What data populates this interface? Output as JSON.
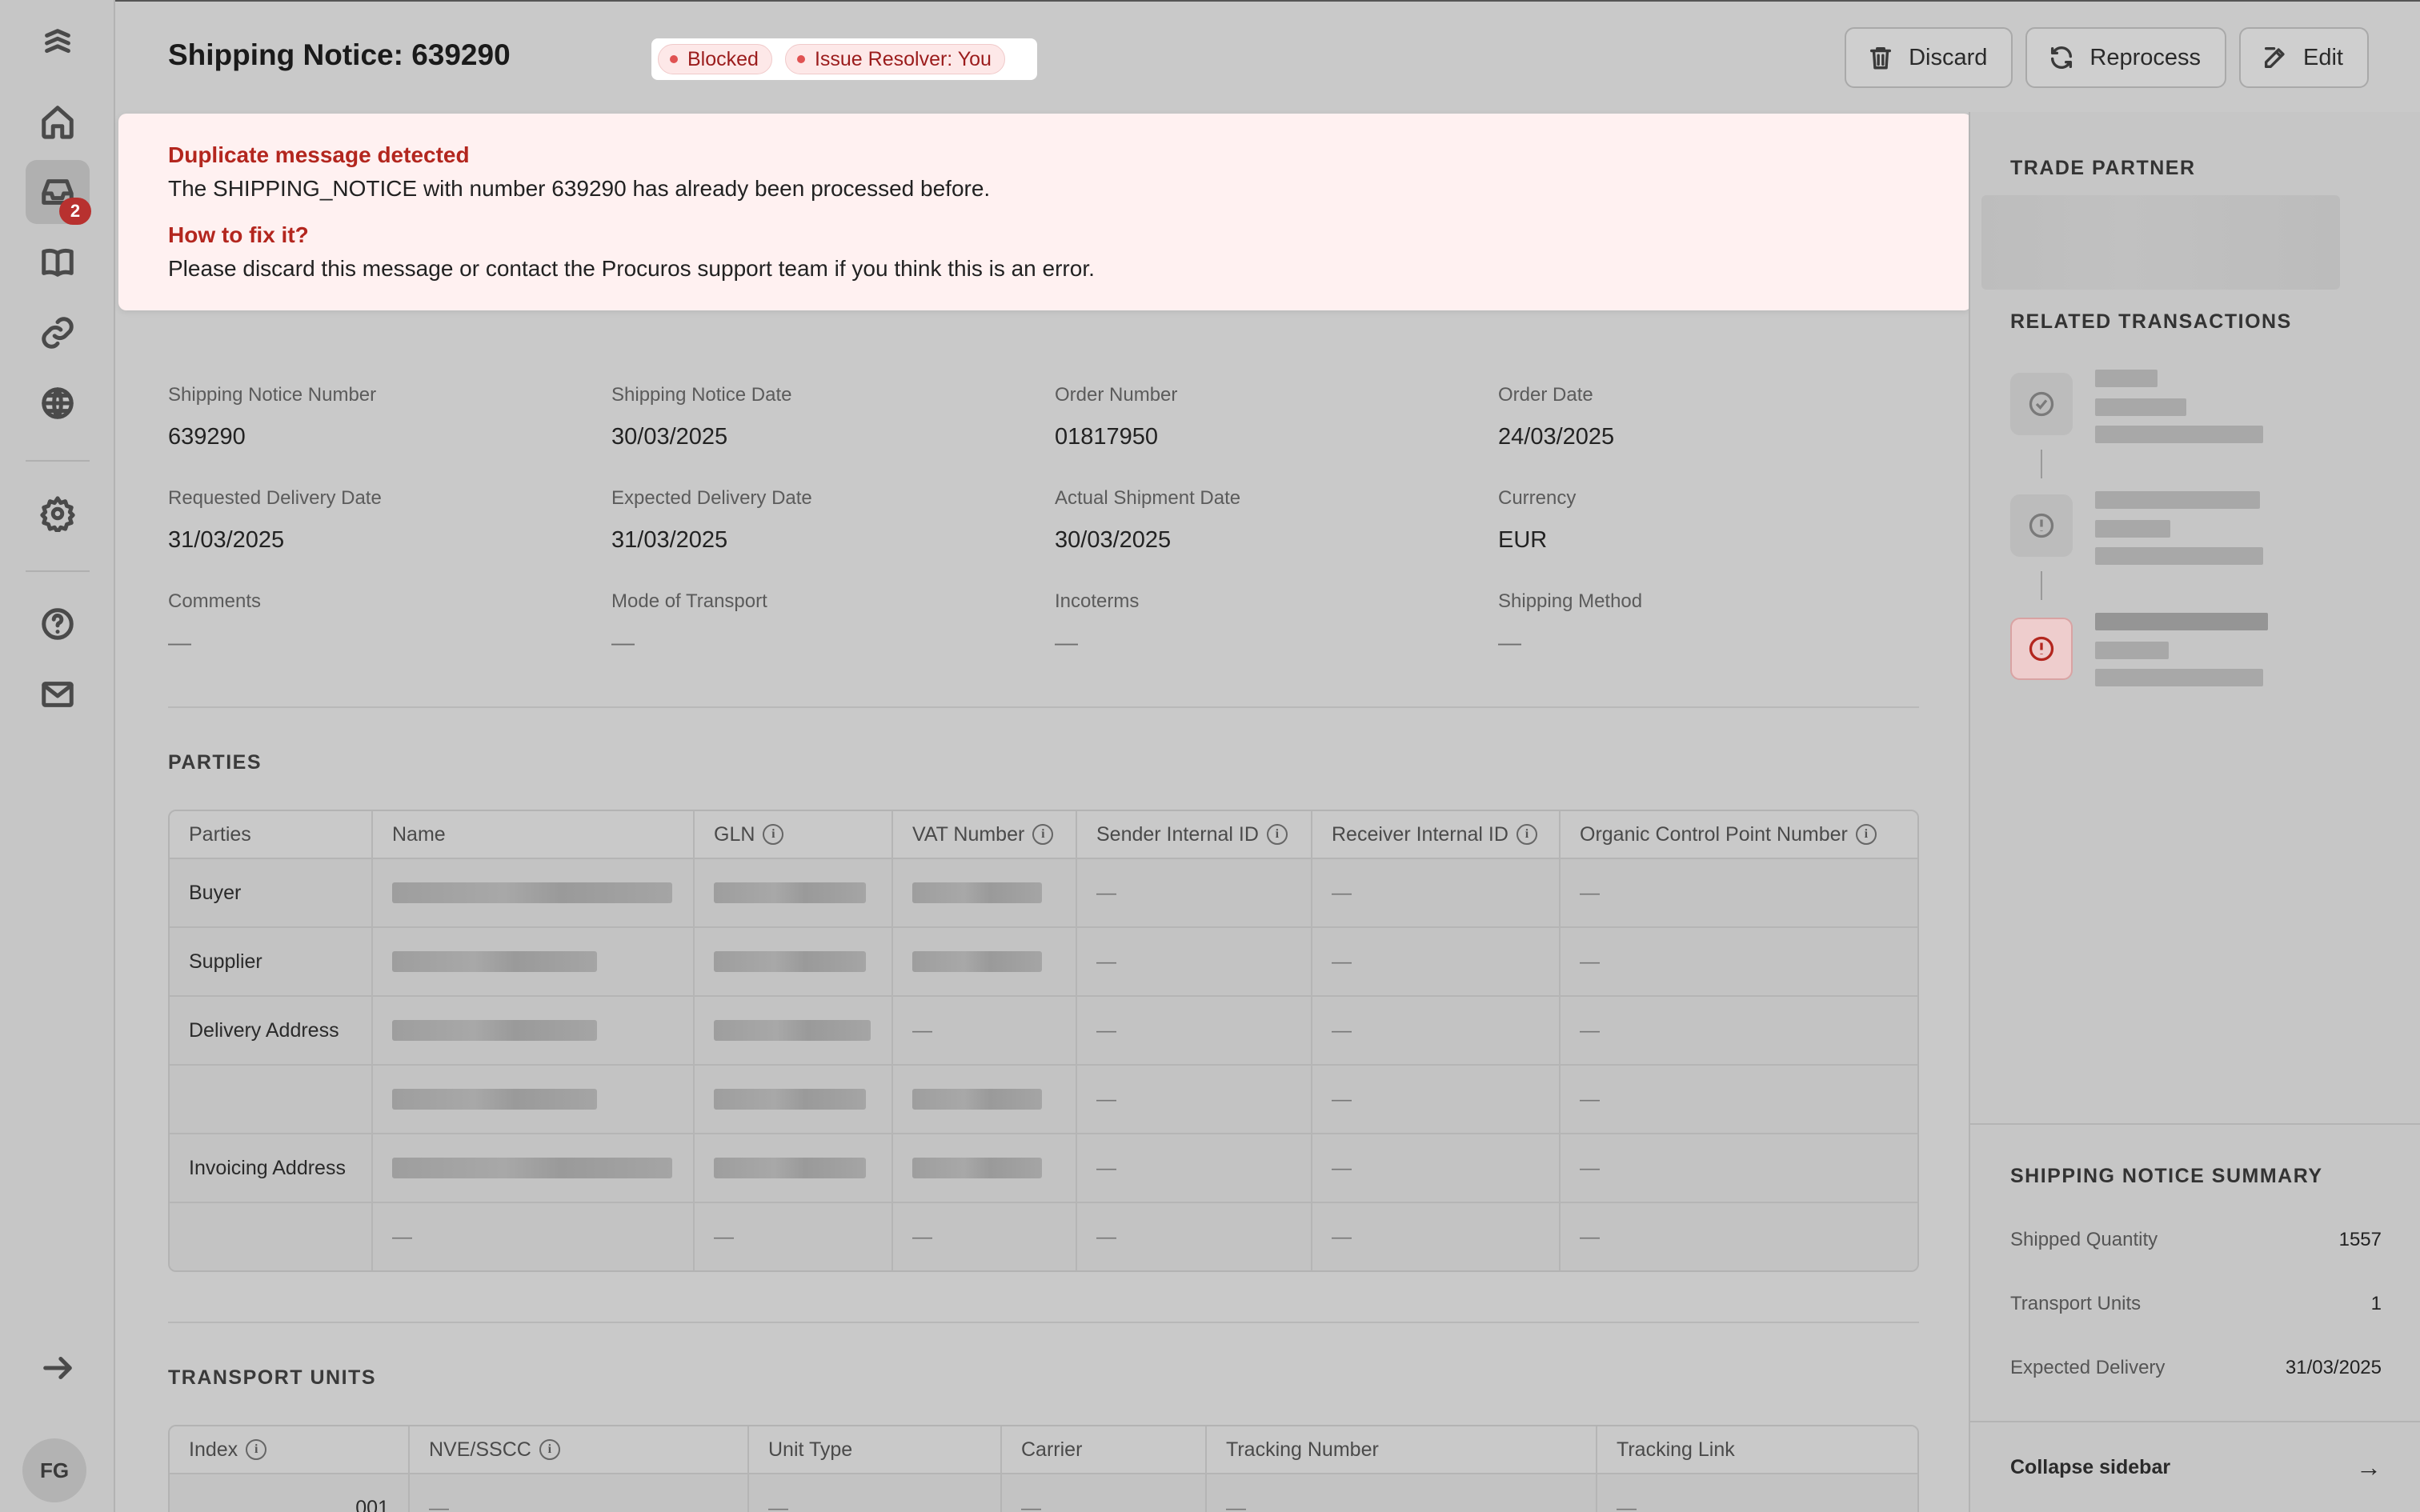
{
  "header": {
    "title": "Shipping Notice: 639290",
    "status_chip": "Blocked",
    "resolver_chip": "Issue Resolver: You",
    "actions": {
      "discard": "Discard",
      "reprocess": "Reprocess",
      "edit": "Edit"
    }
  },
  "nav": {
    "inbox_badge": "2",
    "avatar_initials": "FG"
  },
  "alert": {
    "title": "Duplicate message detected",
    "message": "The SHIPPING_NOTICE with number 639290 has already been processed before.",
    "fix_title": "How to fix it?",
    "fix_message": "Please discard this message or contact the Procuros support team if you think this is an error."
  },
  "details": [
    {
      "label": "Shipping Notice Number",
      "value": "639290"
    },
    {
      "label": "Shipping Notice Date",
      "value": "30/03/2025"
    },
    {
      "label": "Order Number",
      "value": "01817950"
    },
    {
      "label": "Order Date",
      "value": "24/03/2025"
    },
    {
      "label": "Requested Delivery Date",
      "value": "31/03/2025"
    },
    {
      "label": "Expected Delivery Date",
      "value": "31/03/2025"
    },
    {
      "label": "Actual Shipment Date",
      "value": "30/03/2025"
    },
    {
      "label": "Currency",
      "value": "EUR"
    },
    {
      "label": "Comments",
      "value": "—"
    },
    {
      "label": "Mode of Transport",
      "value": "—"
    },
    {
      "label": "Incoterms",
      "value": "—"
    },
    {
      "label": "Shipping Method",
      "value": "—"
    }
  ],
  "parties": {
    "section_title": "PARTIES",
    "columns": [
      "Parties",
      "Name",
      "GLN",
      "VAT Number",
      "Sender Internal ID",
      "Receiver Internal ID",
      "Organic Control Point Number"
    ],
    "rows": [
      {
        "party": "Buyer",
        "cells": [
          "—",
          "—",
          "—"
        ]
      },
      {
        "party": "Supplier",
        "cells": [
          "—",
          "—",
          "—"
        ]
      },
      {
        "party": "Delivery Address",
        "cells": [
          "—",
          "—",
          "—",
          "—"
        ]
      },
      {
        "party": "",
        "cells": [
          "—",
          "—",
          "—"
        ]
      },
      {
        "party": "Invoicing Address",
        "cells": [
          "—",
          "—",
          "—"
        ]
      },
      {
        "party": "",
        "cells": [
          "—",
          "—",
          "—",
          "—",
          "—",
          "—"
        ]
      }
    ]
  },
  "transport": {
    "section_title": "TRANSPORT UNITS",
    "columns": [
      "Index",
      "NVE/SSCC",
      "Unit Type",
      "Carrier",
      "Tracking Number",
      "Tracking Link"
    ],
    "rows": [
      {
        "index": "001",
        "cells": [
          "—",
          "—",
          "—",
          "—",
          "—"
        ]
      }
    ]
  },
  "sidebar": {
    "trade_partner": "TRADE PARTNER",
    "related": "RELATED TRANSACTIONS",
    "summary_title": "SHIPPING NOTICE SUMMARY",
    "summary": [
      {
        "label": "Shipped Quantity",
        "value": "1557"
      },
      {
        "label": "Transport Units",
        "value": "1"
      },
      {
        "label": "Expected Delivery",
        "value": "31/03/2025"
      }
    ],
    "collapse": "Collapse sidebar",
    "collapse_arrow": "→"
  },
  "colors": {
    "error": "#b3261e",
    "alert_bg": "#fff1f1",
    "badge": "#b8312f"
  }
}
